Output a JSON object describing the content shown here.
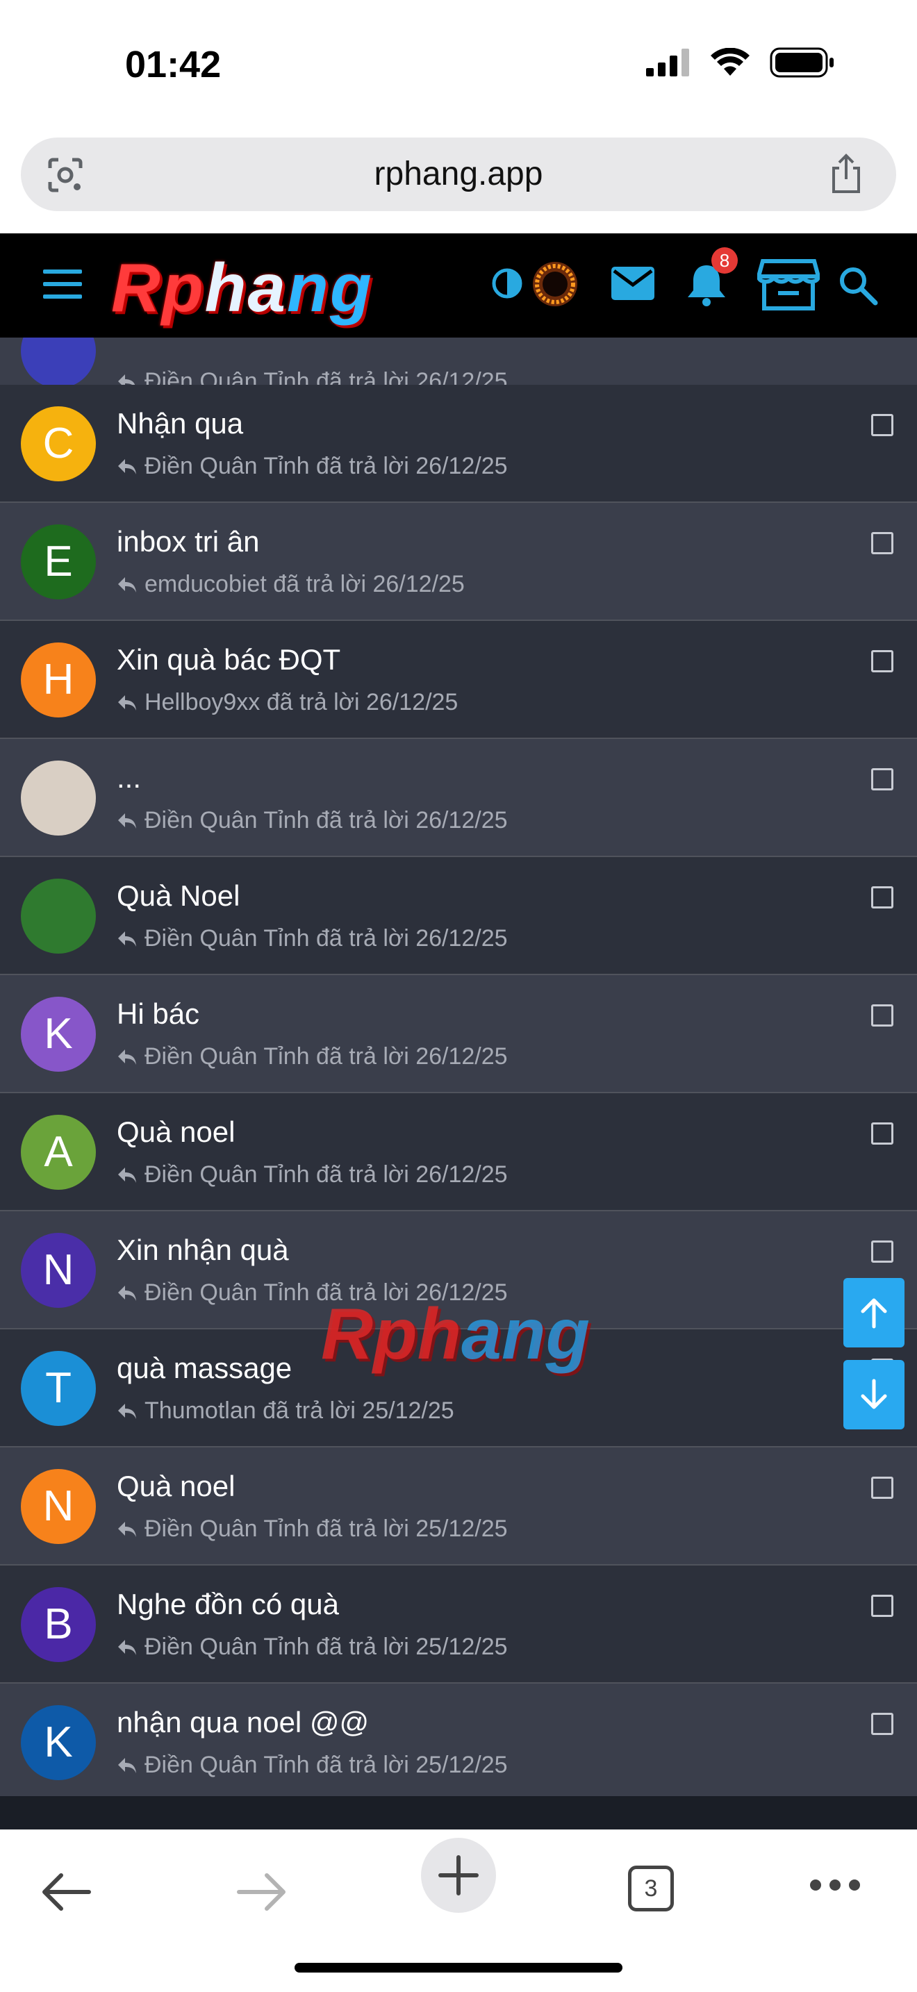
{
  "status_bar": {
    "time": "01:42"
  },
  "browser": {
    "url": "rphang.app",
    "tab_count": "3"
  },
  "header": {
    "logo_text": "Rphang",
    "notification_count": "8"
  },
  "watermark": "Rphang",
  "partial_row": {
    "meta": "Điền Quân Tỉnh đã trả lời 26/12/25",
    "avatar_color": "#3b3fb8"
  },
  "conversations": [
    {
      "title": "Nhận qua",
      "meta": "Điền Quân Tỉnh đã trả lời 26/12/25",
      "avatar_letter": "C",
      "avatar_color": "#f6b20e"
    },
    {
      "title": "inbox tri ân",
      "meta": "emducobiet đã trả lời 26/12/25",
      "avatar_letter": "E",
      "avatar_color": "#1e6b1e"
    },
    {
      "title": "Xin quà bác ĐQT",
      "meta": "Hellboy9xx đã trả lời 26/12/25",
      "avatar_letter": "H",
      "avatar_color": "#f7821b"
    },
    {
      "title": "...",
      "meta": "Điền Quân Tỉnh đã trả lời 26/12/25",
      "avatar_letter": "",
      "avatar_color": "#d9cfc4",
      "avatar_image": "photo-avatar"
    },
    {
      "title": "Quà Noel",
      "meta": "Điền Quân Tỉnh đã trả lời 26/12/25",
      "avatar_letter": "",
      "avatar_color": "#2f7a2f",
      "avatar_image": "spiral-avatar"
    },
    {
      "title": "Hi bác",
      "meta": "Điền Quân Tỉnh đã trả lời 26/12/25",
      "avatar_letter": "K",
      "avatar_color": "#8756c9"
    },
    {
      "title": "Quà noel",
      "meta": "Điền Quân Tỉnh đã trả lời 26/12/25",
      "avatar_letter": "A",
      "avatar_color": "#6aa33a"
    },
    {
      "title": "Xin nhận quà",
      "meta": "Điền Quân Tỉnh đã trả lời 26/12/25",
      "avatar_letter": "N",
      "avatar_color": "#4a2ea8"
    },
    {
      "title": "quà massage",
      "meta": "Thumotlan đã trả lời 25/12/25",
      "avatar_letter": "T",
      "avatar_color": "#1b8fd6"
    },
    {
      "title": "Quà noel",
      "meta": "Điền Quân Tỉnh đã trả lời 25/12/25",
      "avatar_letter": "N",
      "avatar_color": "#f7821b"
    },
    {
      "title": "Nghe đồn có quà",
      "meta": "Điền Quân Tỉnh đã trả lời 25/12/25",
      "avatar_letter": "B",
      "avatar_color": "#4b28a6"
    },
    {
      "title": "nhận qua noel @@",
      "meta": "Điền Quân Tỉnh đã trả lời 25/12/25",
      "avatar_letter": "K",
      "avatar_color": "#0e5aa8"
    }
  ],
  "colors": {
    "accent": "#29a9e0",
    "row_alt": "#3a3e4b",
    "row_norm": "#2c303b",
    "meta_text": "#a7abb5"
  }
}
